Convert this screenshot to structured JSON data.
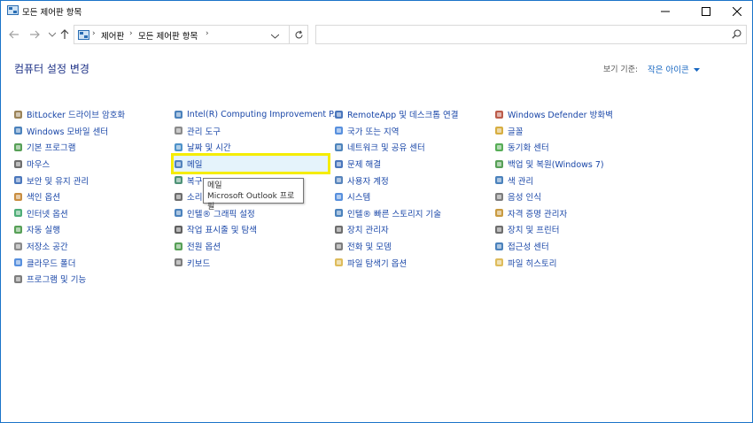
{
  "window": {
    "title": "모든 제어판 항목"
  },
  "address": {
    "crumbs": [
      "제어판",
      "모든 제어판 항목"
    ]
  },
  "page": {
    "title": "컴퓨터 설정 변경",
    "view_by_label": "보기 기준:",
    "view_by_value": "작은 아이콘"
  },
  "columns": [
    [
      {
        "label": "BitLocker 드라이브 암호화",
        "icon": "key-icon",
        "color": "#8a6d3b"
      },
      {
        "label": "Windows 모바일 센터",
        "icon": "mobility-icon",
        "color": "#2b6cb0"
      },
      {
        "label": "기본 프로그램",
        "icon": "default-programs-icon",
        "color": "#3a8f3a"
      },
      {
        "label": "마우스",
        "icon": "mouse-icon",
        "color": "#555555"
      },
      {
        "label": "보안 및 유지 관리",
        "icon": "flag-icon",
        "color": "#2b5fb0"
      },
      {
        "label": "색인 옵션",
        "icon": "indexing-icon",
        "color": "#c07a20"
      },
      {
        "label": "인터넷 옵션",
        "icon": "globe-icon",
        "color": "#2f9f5f"
      },
      {
        "label": "자동 실행",
        "icon": "autoplay-icon",
        "color": "#3a8f3a"
      },
      {
        "label": "저장소 공간",
        "icon": "storage-icon",
        "color": "#777777"
      },
      {
        "label": "클라우드 폴더",
        "icon": "cloud-folder-icon",
        "color": "#3b7dd8"
      },
      {
        "label": "프로그램 및 기능",
        "icon": "programs-icon",
        "color": "#666666"
      }
    ],
    [
      {
        "label": "Intel(R) Computing Improvement P...",
        "icon": "intel-icon",
        "color": "#2b6cb0"
      },
      {
        "label": "관리 도구",
        "icon": "admin-tools-icon",
        "color": "#777777"
      },
      {
        "label": "날짜 및 시간",
        "icon": "clock-icon",
        "color": "#2f7fbf"
      },
      {
        "label": "메일",
        "icon": "mail-icon",
        "color": "#3a6fb0"
      },
      {
        "label": "복구",
        "icon": "recovery-icon",
        "color": "#2f7f5f"
      },
      {
        "label": "소리",
        "icon": "sound-icon",
        "color": "#555555"
      },
      {
        "label": "인텔® 그래픽 설정",
        "icon": "intel-graphics-icon",
        "color": "#2b6cb0"
      },
      {
        "label": "작업 표시줄 및 탐색",
        "icon": "taskbar-icon",
        "color": "#444444"
      },
      {
        "label": "전원 옵션",
        "icon": "power-icon",
        "color": "#3a8f3a"
      },
      {
        "label": "키보드",
        "icon": "keyboard-icon",
        "color": "#666666"
      }
    ],
    [
      {
        "label": "RemoteApp 및 데스크톱 연결",
        "icon": "remoteapp-icon",
        "color": "#2b5fb0"
      },
      {
        "label": "국가 또는 지역",
        "icon": "region-icon",
        "color": "#3b7dd8"
      },
      {
        "label": "네트워크 및 공유 센터",
        "icon": "network-icon",
        "color": "#2f6fb0"
      },
      {
        "label": "문제 해결",
        "icon": "troubleshoot-icon",
        "color": "#2b5fb0"
      },
      {
        "label": "사용자 계정",
        "icon": "user-accounts-icon",
        "color": "#3a6fb0"
      },
      {
        "label": "시스템",
        "icon": "system-icon",
        "color": "#3b7dd8"
      },
      {
        "label": "인텔® 빠른 스토리지 기술",
        "icon": "intel-storage-icon",
        "color": "#2b6cb0"
      },
      {
        "label": "장치 관리자",
        "icon": "device-manager-icon",
        "color": "#555555"
      },
      {
        "label": "전화 및 모뎀",
        "icon": "phone-icon",
        "color": "#666666"
      },
      {
        "label": "파일 탐색기 옵션",
        "icon": "folder-options-icon",
        "color": "#d8b040"
      }
    ],
    [
      {
        "label": "Windows Defender 방화벽",
        "icon": "firewall-icon",
        "color": "#b0402b"
      },
      {
        "label": "글꼴",
        "icon": "fonts-icon",
        "color": "#d0a020"
      },
      {
        "label": "동기화 센터",
        "icon": "sync-icon",
        "color": "#3a9f3a"
      },
      {
        "label": "백업 및 복원(Windows 7)",
        "icon": "backup-icon",
        "color": "#3a8f3a"
      },
      {
        "label": "색 관리",
        "icon": "color-management-icon",
        "color": "#2b6cb0"
      },
      {
        "label": "음성 인식",
        "icon": "microphone-icon",
        "color": "#666666"
      },
      {
        "label": "자격 증명 관리자",
        "icon": "credential-icon",
        "color": "#c08a20"
      },
      {
        "label": "장치 및 프린터",
        "icon": "printer-icon",
        "color": "#555555"
      },
      {
        "label": "접근성 센터",
        "icon": "accessibility-icon",
        "color": "#2b6cb0"
      },
      {
        "label": "파일 히스토리",
        "icon": "file-history-icon",
        "color": "#d8b040"
      }
    ]
  ],
  "tooltip": {
    "title": "메일",
    "description": "Microsoft Outlook 프로필"
  }
}
